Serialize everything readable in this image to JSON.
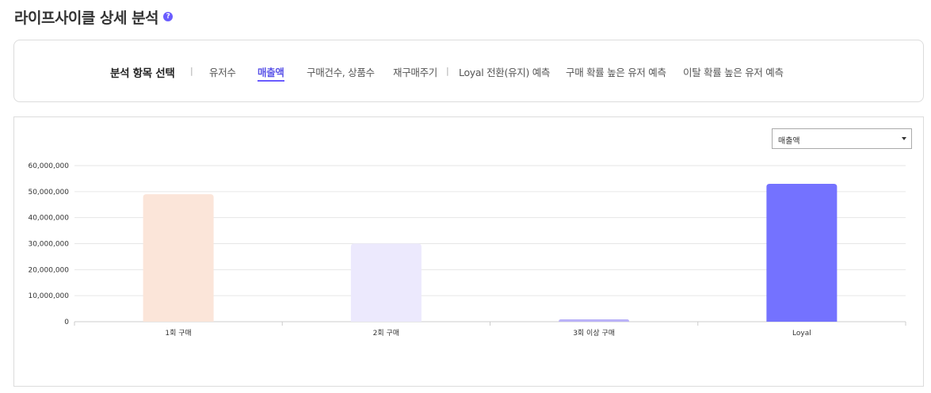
{
  "page": {
    "title": "라이프사이클 상세 분석",
    "help_glyph": "?"
  },
  "tabs": {
    "heading": "분석 항목 선택",
    "separator": "|",
    "items": [
      {
        "label": "유저수",
        "active": false
      },
      {
        "label": "매출액",
        "active": true
      },
      {
        "label": "구매건수, 상품수",
        "active": false
      },
      {
        "label": "재구매주기",
        "active": false
      },
      {
        "label": "Loyal 전환(유지) 예측",
        "active": false
      },
      {
        "label": "구매 확률 높은 유저 예측",
        "active": false
      },
      {
        "label": "이탈 확률 높은 유저 예측",
        "active": false
      }
    ]
  },
  "metric_select": {
    "value": "매출액"
  },
  "chart_data": {
    "type": "bar",
    "categories": [
      "1회 구매",
      "2회 구매",
      "3회 이상 구매",
      "Loyal"
    ],
    "values": [
      49000000,
      30000000,
      900000,
      53000000
    ],
    "colors": [
      "#fbe5d9",
      "#ece9fd",
      "#bab2f8",
      "#7472ff"
    ],
    "ylim": [
      0,
      60000000
    ],
    "yticks": [
      0,
      10000000,
      20000000,
      30000000,
      40000000,
      50000000,
      60000000
    ],
    "ytick_labels": [
      "0",
      "10,000,000",
      "20,000,000",
      "30,000,000",
      "40,000,000",
      "50,000,000",
      "60,000,000"
    ],
    "grid": true,
    "legend": "none"
  }
}
